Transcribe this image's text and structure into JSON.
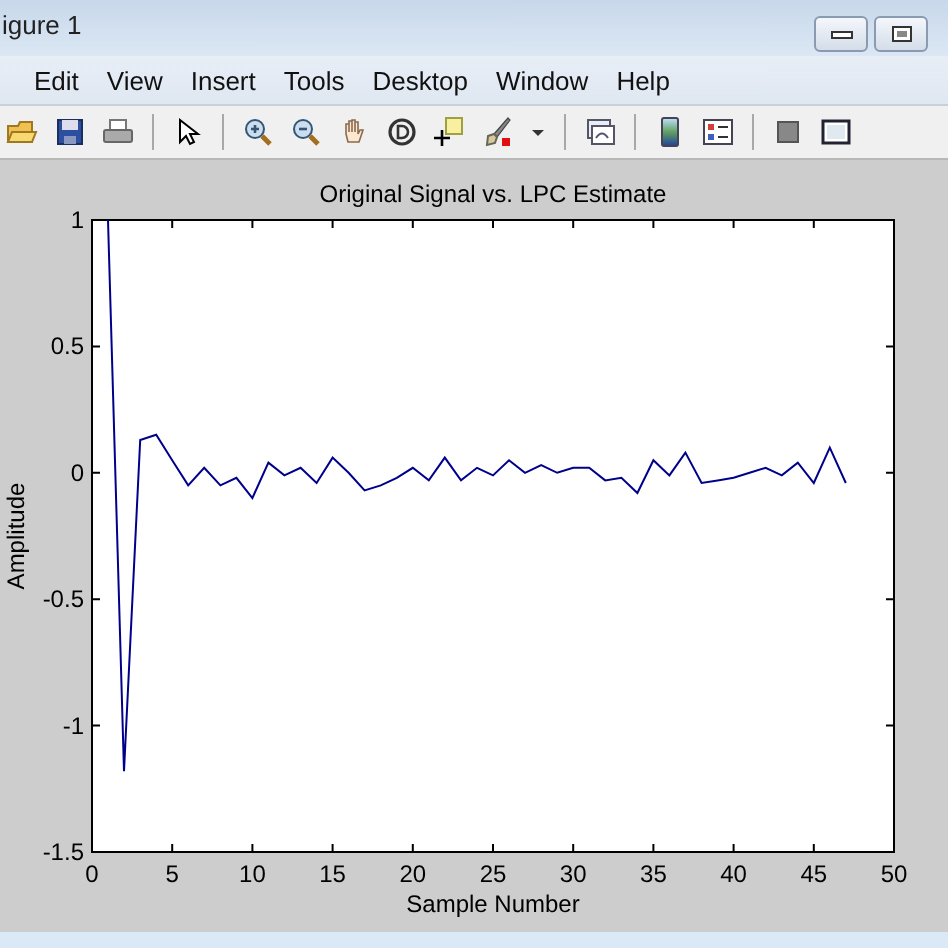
{
  "window": {
    "title": "igure 1"
  },
  "menu": [
    "Edit",
    "View",
    "Insert",
    "Tools",
    "Desktop",
    "Window",
    "Help"
  ],
  "axes": {
    "chart_data": {
      "type": "line",
      "title": "Original Signal vs. LPC Estimate",
      "xlabel": "Sample Number",
      "ylabel": "Amplitude",
      "x": [
        1,
        2,
        3,
        4,
        5,
        6,
        7,
        8,
        9,
        10,
        11,
        12,
        13,
        14,
        15,
        16,
        17,
        18,
        19,
        20,
        21,
        22,
        23,
        24,
        25,
        26,
        27,
        28,
        29,
        30,
        31,
        32,
        33,
        34,
        35,
        36,
        37,
        38,
        39,
        40,
        41,
        42,
        43,
        44,
        45,
        46,
        47
      ],
      "series": [
        {
          "color": "#00008b",
          "values": [
            1,
            -1.18,
            0.13,
            0.15,
            0.05,
            -0.05,
            0.02,
            -0.05,
            -0.02,
            -0.1,
            0.04,
            -0.01,
            0.02,
            -0.04,
            0.06,
            0,
            -0.07,
            -0.05,
            -0.02,
            0.02,
            -0.03,
            0.06,
            -0.03,
            0.02,
            -0.01,
            0.05,
            0,
            0.03,
            0,
            0.02,
            0.02,
            -0.03,
            -0.02,
            -0.08,
            0.05,
            -0.01,
            0.08,
            -0.04,
            -0.03,
            -0.02,
            0,
            0.02,
            -0.01,
            0.04,
            -0.04,
            0.1,
            -0.04
          ]
        }
      ],
      "xlim": [
        0,
        50
      ],
      "ylim": [
        -1.5,
        1
      ],
      "xticks": [
        0,
        5,
        10,
        15,
        20,
        25,
        30,
        35,
        40,
        45,
        50
      ],
      "yticks": [
        -1.5,
        -1,
        -0.5,
        0,
        0.5,
        1
      ]
    }
  }
}
